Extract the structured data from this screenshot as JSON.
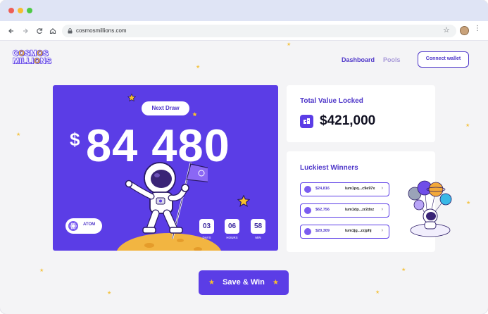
{
  "browser": {
    "url": "cosmosmillions.com"
  },
  "logo": {
    "line1": "COSMOS",
    "line2": "MILLIONS"
  },
  "nav": {
    "dashboard": "Dashboard",
    "pools": "Pools",
    "connect_wallet": "Connect wallet"
  },
  "prize": {
    "next_draw_label": "Next Draw",
    "currency": "$",
    "amount": "84 480",
    "token": "ATOM",
    "countdown": [
      {
        "value": "03",
        "unit": "DAYS"
      },
      {
        "value": "06",
        "unit": "HOURS"
      },
      {
        "value": "58",
        "unit": "MIN"
      }
    ]
  },
  "tvl": {
    "title": "Total Value Locked",
    "value": "$421,000"
  },
  "winners": {
    "title": "Luckiest Winners",
    "rows": [
      {
        "amount": "$24,816",
        "address": "lum1pq...c9e97x"
      },
      {
        "amount": "$62,756",
        "address": "lum1dp...zr2dxz"
      },
      {
        "amount": "$20,309",
        "address": "lum1jg...zzjphj"
      }
    ]
  },
  "cta": {
    "save_win": "Save & Win"
  },
  "colors": {
    "primary": "#5b3de6",
    "primary_dark": "#4e36c9",
    "accent_yellow": "#f8c12c",
    "background": "#f4f4f6"
  },
  "icons": {
    "back": "arrow-left-icon",
    "forward": "arrow-right-icon",
    "reload": "reload-icon",
    "home": "home-icon",
    "lock": "lock-icon",
    "bookmark": "star-icon",
    "menu": "kebab-menu-icon",
    "chevron": "chevron-right-icon",
    "star": "star-icon",
    "atom": "atom-icon"
  }
}
